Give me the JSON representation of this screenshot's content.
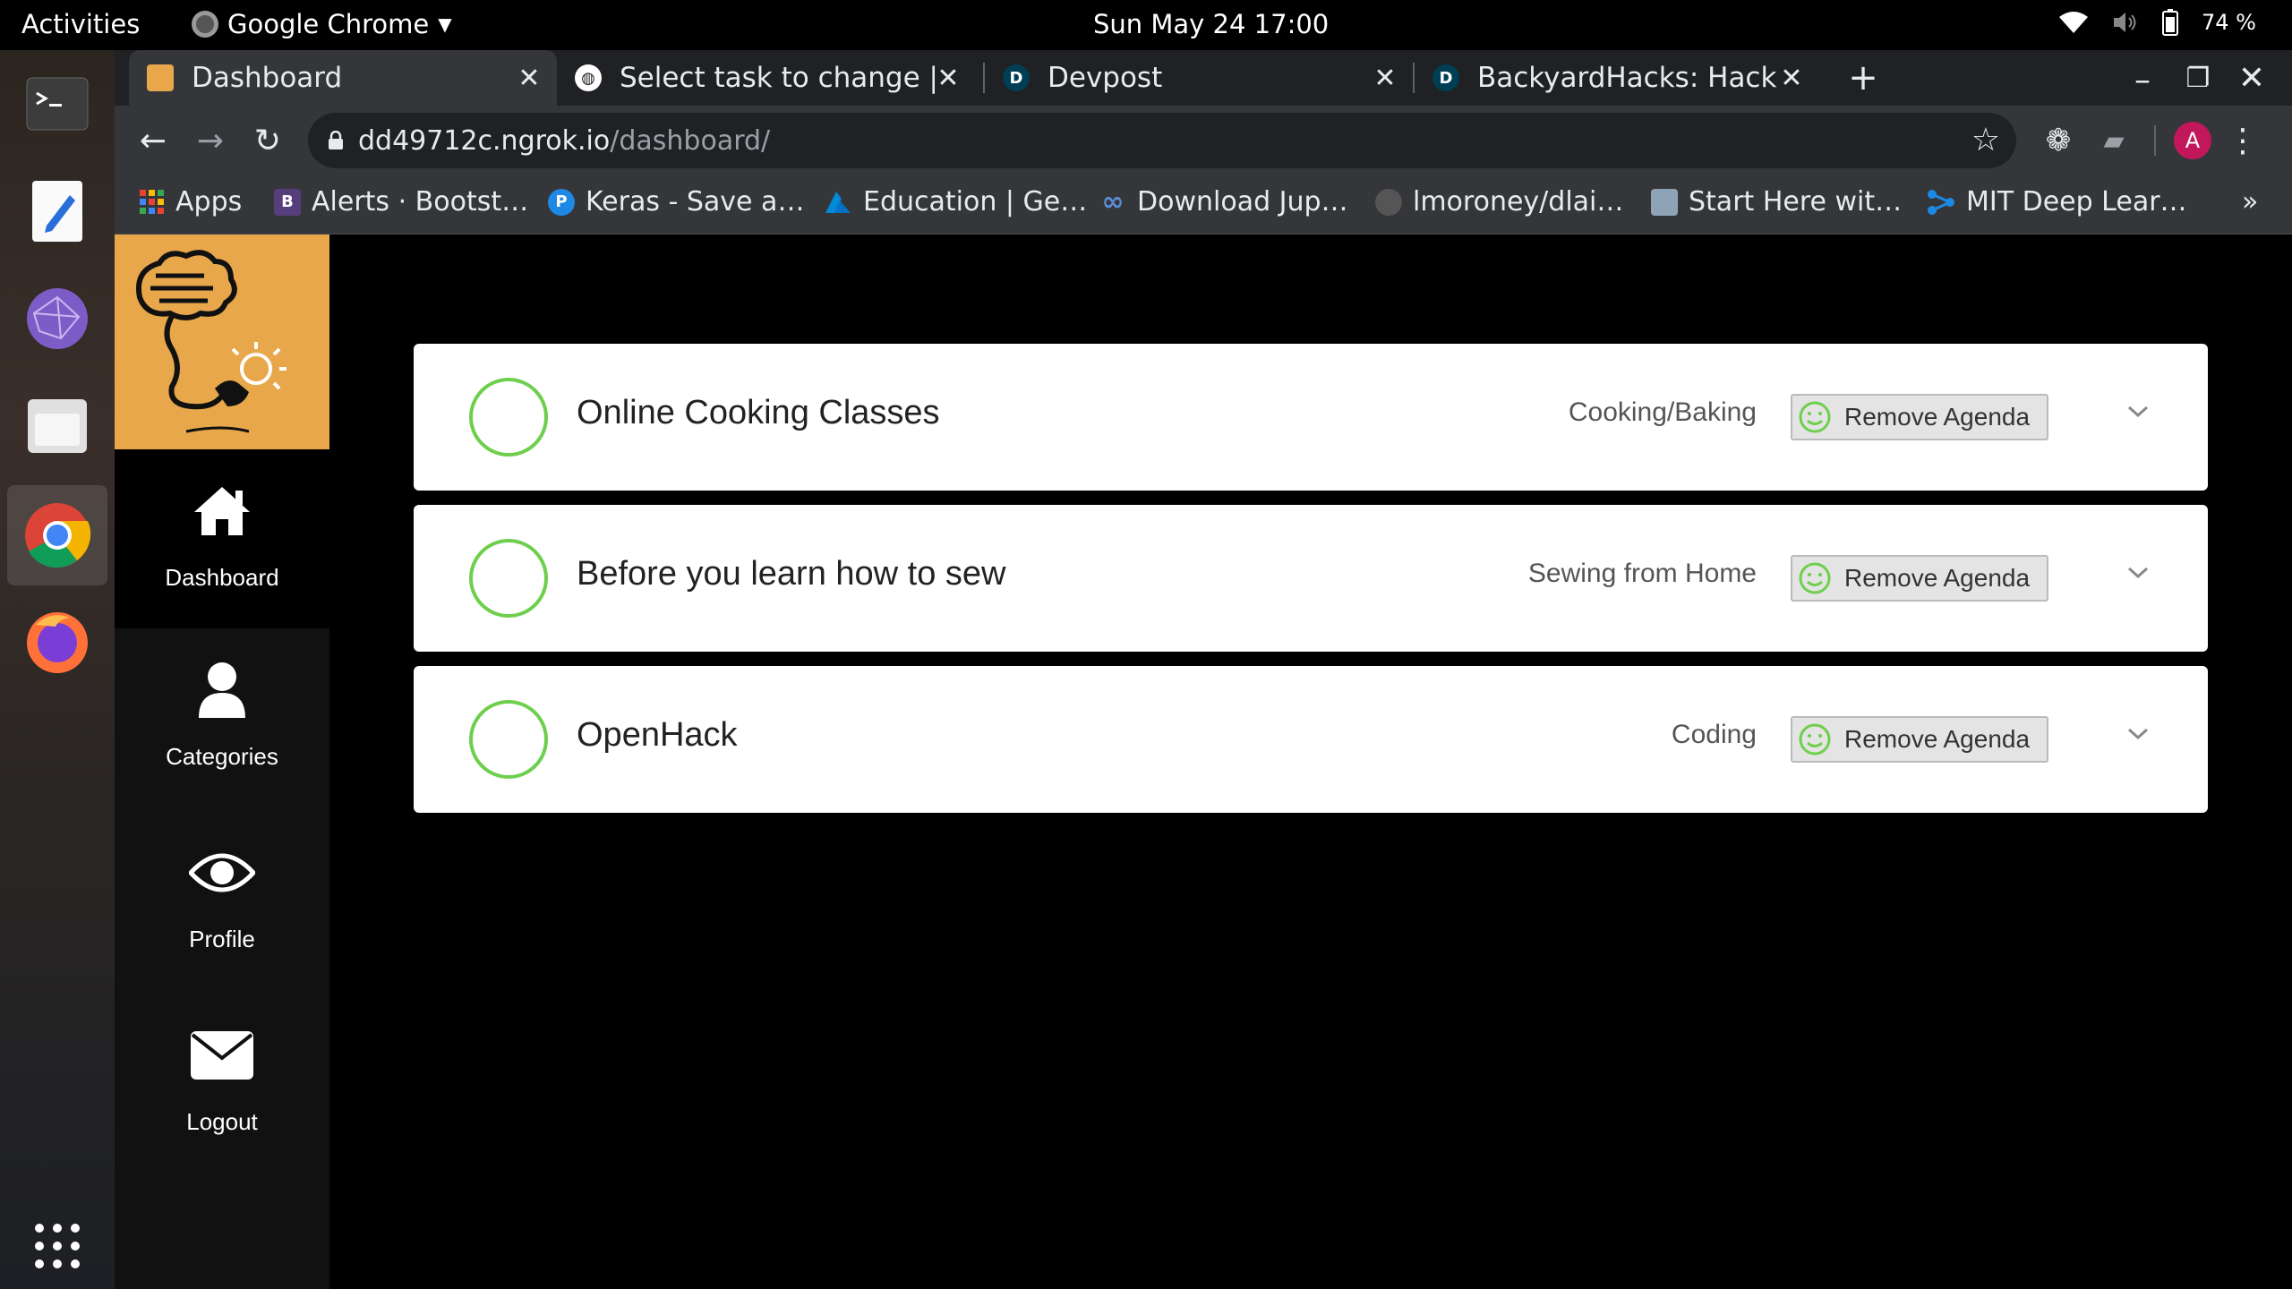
{
  "os": {
    "activities": "Activities",
    "app_menu": "Google Chrome",
    "clock": "Sun May 24  17:00",
    "battery": "74 %"
  },
  "browser": {
    "tabs": [
      {
        "label": "Dashboard",
        "favicon": "site-logo-icon"
      },
      {
        "label": "Select task to change | Dja",
        "favicon": "globe-icon"
      },
      {
        "label": "Devpost",
        "favicon": "devpost-icon",
        "favicon_text": "D"
      },
      {
        "label": "BackyardHacks: Hacks tha",
        "favicon": "devpost-icon",
        "favicon_text": "D"
      }
    ],
    "url_host": "dd49712c.ngrok.io",
    "url_path": "/dashboard/",
    "profile_initial": "A",
    "bookmarks": [
      {
        "label": "Apps",
        "icon": "apps-grid-icon"
      },
      {
        "label": "Alerts · Bootst…",
        "icon": "bootstrap-icon",
        "icon_text": "B"
      },
      {
        "label": "Keras - Save a…",
        "icon": "pi-icon",
        "icon_text": "P"
      },
      {
        "label": "Education | Ge…",
        "icon": "azure-icon"
      },
      {
        "label": "Download Jup…",
        "icon": "infinity-icon"
      },
      {
        "label": "lmoroney/dlai…",
        "icon": "github-icon"
      },
      {
        "label": "Start Here wit…",
        "icon": "image-icon"
      },
      {
        "label": "MIT Deep Lear…",
        "icon": "network-icon"
      }
    ],
    "more_bookmarks": "»"
  },
  "sidebar": {
    "items": [
      {
        "label": "Dashboard",
        "icon": "home-icon",
        "active": true
      },
      {
        "label": "Categories",
        "icon": "user-icon"
      },
      {
        "label": "Profile",
        "icon": "eye-icon"
      },
      {
        "label": "Logout",
        "icon": "envelope-icon"
      }
    ]
  },
  "agendas": [
    {
      "title": "Online Cooking Classes",
      "category": "Cooking/Baking",
      "action": "Remove Agenda"
    },
    {
      "title": "Before you learn how to sew",
      "category": "Sewing from Home",
      "action": "Remove Agenda"
    },
    {
      "title": "OpenHack",
      "category": "Coding",
      "action": "Remove Agenda"
    }
  ],
  "colors": {
    "accent_green": "#6ecf4d",
    "logo_bg": "#e7a74a",
    "profile_avatar": "#c2185b"
  }
}
